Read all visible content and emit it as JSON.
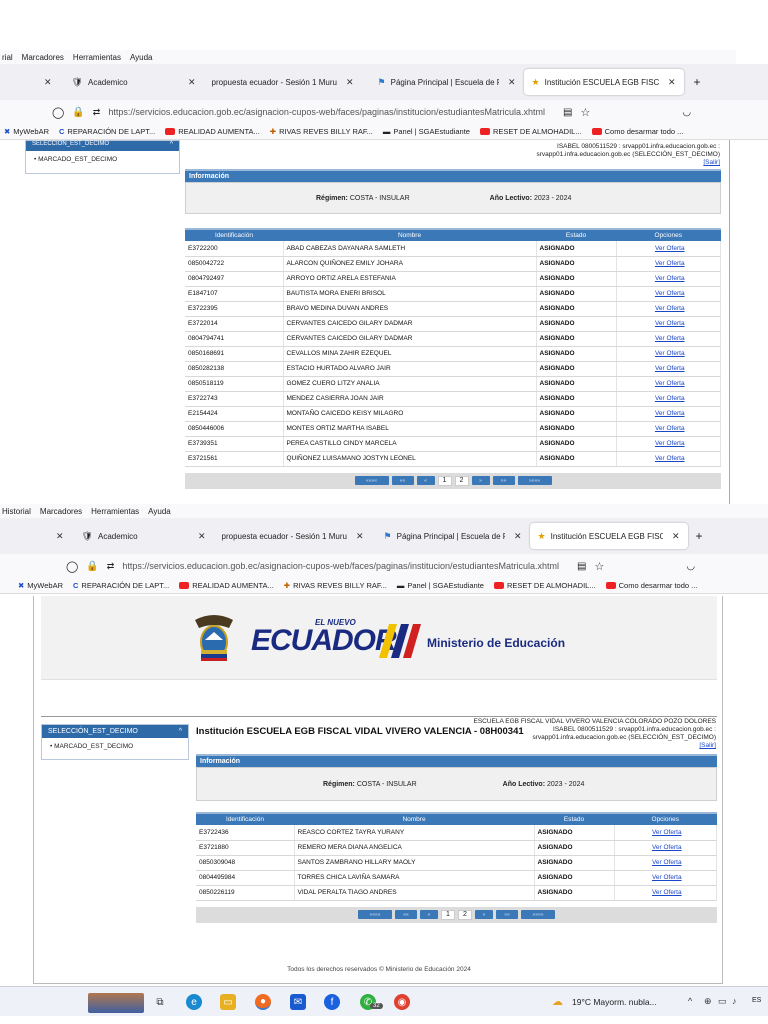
{
  "browser_top": {
    "menu": [
      "rial",
      "Marcadores",
      "Herramientas",
      "Ayuda"
    ],
    "tabs": [
      {
        "label": "Academico",
        "active": false
      },
      {
        "label": "propuesta ecuador - Sesión 1 Muru",
        "active": false
      },
      {
        "label": "Página Principal | Escuela de Fo",
        "active": false
      },
      {
        "label": "Institución ESCUELA EGB FISCAL",
        "active": true
      }
    ],
    "url": "https://servicios.educacion.gob.ec/asignacion-cupos-web/faces/paginas/institucion/estudiantesMatricula.xhtml"
  },
  "browser_bottom": {
    "menu": [
      "Historial",
      "Marcadores",
      "Herramientas",
      "Ayuda"
    ],
    "tabs": [
      {
        "label": "Academico",
        "active": false
      },
      {
        "label": "propuesta ecuador - Sesión 1 Muru",
        "active": false
      },
      {
        "label": "Página Principal | Escuela de Fo",
        "active": false
      },
      {
        "label": "Institución ESCUELA EGB FISCA",
        "active": true
      }
    ],
    "url": "https://servicios.educacion.gob.ec/asignacion-cupos-web/faces/paginas/institucion/estudiantesMatricula.xhtml"
  },
  "bookmarks": [
    "MyWebAR",
    "REPARACIÓN DE LAPT...",
    "REALIDAD AUMENTA...",
    "RIVAS REVES BILLY RAF...",
    "Panel | SGAEstudiante",
    "RESET DE ALMOHADIL...",
    "Como desarmar todo ..."
  ],
  "bookmarks_bottom": [
    "MyWebAR",
    "REPARACIÓN DE LAPT...",
    "REALIDAD AUMENTA...",
    "RIVAS REVES BILLY RAF...",
    "Panel | SGAEstudiante",
    "RESET DE ALMOHADIL...",
    "Como desarmar todo ..."
  ],
  "app": {
    "sidebar_head": "SELECCIÓN_EST_DECIMO",
    "sidebar_item": "MARCADO_EST_DECIMO",
    "user_line1": "ISABEL 0800511529 : srvapp01.infra.educacion.gob.ec :",
    "user_line2": "srvapp01.infra.educacion.gob.ec (SELECCIÓN_EST_DECIMO)",
    "salir": "[Salir]",
    "info_title": "Información",
    "regimen_label": "Régimen:",
    "regimen_value": "COSTA - INSULAR",
    "anio_label": "Año Lectivo:",
    "anio_value": "2023 - 2024",
    "columns": [
      "Identificación",
      "Nombre",
      "Estado",
      "Opciones"
    ],
    "link_label": "Ver Oferta",
    "page1_rows": [
      [
        "E3722200",
        "ABAD CABEZAS DAYANARA SAMLETH",
        "ASIGNADO"
      ],
      [
        "0850042722",
        "ALARCON QUIÑONEZ EMILY JOHARA",
        "ASIGNADO"
      ],
      [
        "0804792497",
        "ARROYO ORTIZ ARELA ESTEFANIA",
        "ASIGNADO"
      ],
      [
        "E1847107",
        "BAUTISTA MORA ENERI BRISOL",
        "ASIGNADO"
      ],
      [
        "E3722395",
        "BRAVO MEDINA DUVAN ANDRES",
        "ASIGNADO"
      ],
      [
        "E3722014",
        "CERVANTES CAICEDO GILARY DADMAR",
        "ASIGNADO"
      ],
      [
        "0804794741",
        "CERVANTES CAICEDO GILARY DADMAR",
        "ASIGNADO"
      ],
      [
        "0850168691",
        "CEVALLOS MINA ZAHIR EZEQUEL",
        "ASIGNADO"
      ],
      [
        "0850282138",
        "ESTACIO HURTADO ALVARO JAIR",
        "ASIGNADO"
      ],
      [
        "0850518119",
        "GOMEZ CUERO LITZY ANALIA",
        "ASIGNADO"
      ],
      [
        "E3722743",
        "MENDEZ CASIERRA JOAN JAIR",
        "ASIGNADO"
      ],
      [
        "E2154424",
        "MONTAÑO CAICEDO KEISY MILAGRO",
        "ASIGNADO"
      ],
      [
        "0850446006",
        "MONTES ORTIZ MARTHA ISABEL",
        "ASIGNADO"
      ],
      [
        "E3739351",
        "PEREA CASTILLO CINDY MARCELA",
        "ASIGNADO"
      ],
      [
        "E3721561",
        "QUIÑONEZ LUISAMANO JOSTYN LEONEL",
        "ASIGNADO"
      ]
    ],
    "page2_rows": [
      [
        "E3722436",
        "REASCO CORTEZ TAYRA YURANY",
        "ASIGNADO"
      ],
      [
        "E3721880",
        "REMERO MERA DIANA ANGELICA",
        "ASIGNADO"
      ],
      [
        "0850309048",
        "SANTOS ZAMBRANO HILLARY MAOLY",
        "ASIGNADO"
      ],
      [
        "0804495984",
        "TORRES CHICA LAVIÑA SAMARA",
        "ASIGNADO"
      ],
      [
        "0850226119",
        "VIDAL PERALTA TIAGO ANDRES",
        "ASIGNADO"
      ]
    ],
    "pager_first": "««««",
    "pager_prev2": "««",
    "pager_prev": "«",
    "pager_pages": [
      "1",
      "2"
    ],
    "pager_next": "»",
    "pager_next2": "»»",
    "pager_last": "»»»»",
    "institution_title": "Institución ESCUELA EGB FISCAL VIDAL VIVERO VALENCIA - 08H00341",
    "institution_line": "ESCUELA EGB FISCAL VIDAL VIVERO VALENCIA COLORADO POZO DOLORES",
    "user_line_b1": "ISABEL 0800511529 : srvapp01.infra.educacion.gob.ec :",
    "user_line_b2": "srvapp01.infra.educacion.gob.ec (SELECCIÓN_EST_DECIMO)",
    "brand_top": "EL NUEVO",
    "brand_main": "ECUADOR",
    "ministry": "Ministerio de Educación",
    "footer": "Todos los derechos reservados © Ministerio de Educación 2024"
  },
  "taskbar": {
    "weather": "19°C  Mayorm. nubla...",
    "badge": "32",
    "lang": "ES"
  },
  "colors": {
    "header_blue": "#3b78b8",
    "status_green": "#1a8a1a",
    "link_blue": "#1a46c8"
  }
}
